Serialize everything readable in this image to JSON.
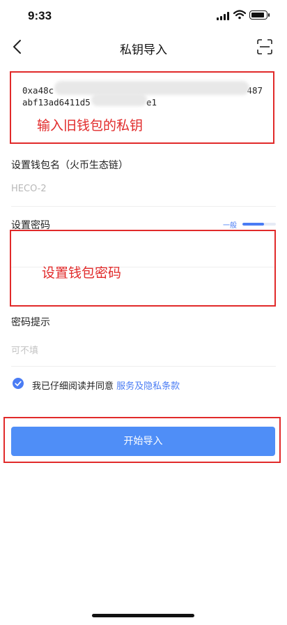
{
  "status_bar": {
    "time": "9:33"
  },
  "nav": {
    "title": "私钥导入"
  },
  "key_input": {
    "line1_start": "0xa48c",
    "line1_end": "487",
    "line2_start": "abf13ad6411d5",
    "line2_end": "e1"
  },
  "annotations": {
    "key_hint": "输入旧钱包的私钥",
    "password_hint": "设置钱包密码"
  },
  "wallet_name": {
    "label": "设置钱包名（火币生态链）",
    "value": "HECO-2"
  },
  "password": {
    "label": "设置密码",
    "strength_label": "一般",
    "strength_level": 0.65
  },
  "password_hint_field": {
    "label": "密码提示",
    "placeholder": "可不填"
  },
  "agreement": {
    "text": "我已仔细阅读并同意",
    "link": "服务及隐私条款"
  },
  "import_button": {
    "label": "开始导入"
  },
  "colors": {
    "accent": "#4a7cf4",
    "button": "#4f8ef7",
    "annotation": "#e12a2a"
  }
}
